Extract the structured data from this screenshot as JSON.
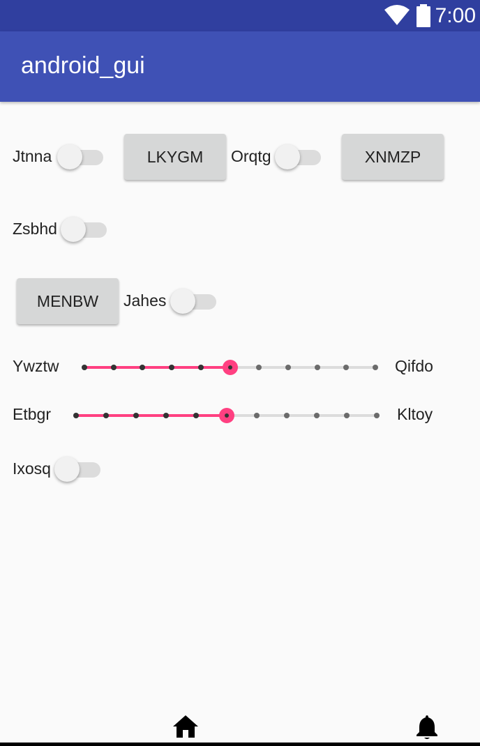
{
  "status_bar": {
    "time": "7:00",
    "icons": [
      "wifi-icon",
      "battery-icon"
    ],
    "color": "#303f9f"
  },
  "app_bar": {
    "title": "android_gui",
    "color": "#3f51b5"
  },
  "switches": [
    {
      "label": "Jtnna",
      "on": false
    },
    {
      "label": "Orqtg",
      "on": false
    },
    {
      "label": "Zsbhd",
      "on": false
    },
    {
      "label": "Jahes",
      "on": false
    },
    {
      "label": "Ixosq",
      "on": false
    }
  ],
  "buttons": [
    {
      "label": "LKYGM"
    },
    {
      "label": "XNMZP"
    },
    {
      "label": "MENBW"
    }
  ],
  "sliders": [
    {
      "left_label": "Ywztw",
      "right_label": "Qifdo",
      "value": 5,
      "max": 10
    },
    {
      "left_label": "Etbgr",
      "right_label": "Kltoy",
      "value": 5,
      "max": 10
    }
  ],
  "accent_color": "#ff4081",
  "bottom_nav": {
    "icons": [
      "home-icon",
      "bell-icon"
    ]
  }
}
